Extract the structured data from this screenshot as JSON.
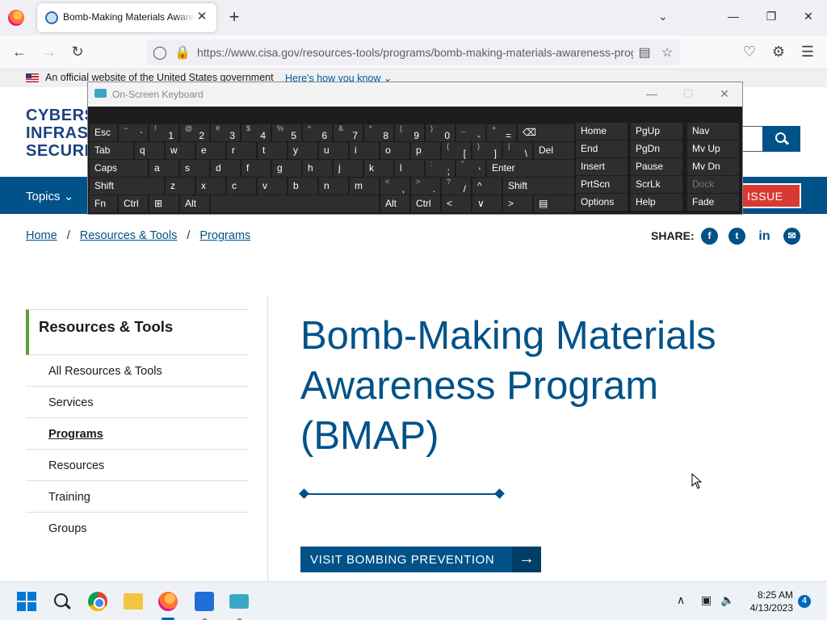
{
  "browser": {
    "tab_title": "Bomb-Making Materials Awareness Program (BMAP) | CISA",
    "tab_close": "✕",
    "new_tab": "+",
    "url": "https://www.cisa.gov/resources-tools/programs/bomb-making-materials-awareness-program-bmap"
  },
  "gov_banner": {
    "text": "An official website of the United States government",
    "link": "Here's how you know"
  },
  "site": {
    "logo_lines": [
      "CYBERSE",
      "INFRAST",
      "SECURIT"
    ],
    "topics_label": "Topics",
    "report_label": "R ISSUE"
  },
  "breadcrumb": [
    "Home",
    "Resources & Tools",
    "Programs"
  ],
  "breadcrumb_sep": "/",
  "share_label": "SHARE:",
  "social": [
    "f",
    "t",
    "in",
    "✉"
  ],
  "sidebar": {
    "heading": "Resources & Tools",
    "items": [
      {
        "label": "All Resources & Tools",
        "active": false
      },
      {
        "label": "Services",
        "active": false
      },
      {
        "label": "Programs",
        "active": true
      },
      {
        "label": "Resources",
        "active": false
      },
      {
        "label": "Training",
        "active": false
      },
      {
        "label": "Groups",
        "active": false
      }
    ]
  },
  "main": {
    "title": "Bomb-Making Materials Awareness Program (BMAP)",
    "cta_label": "VISIT BOMBING PREVENTION",
    "cta_arrow": "→"
  },
  "osk": {
    "title": "On-Screen Keyboard",
    "rows": [
      [
        {
          "l": "Esc"
        },
        {
          "s": "~",
          "m": "`"
        },
        {
          "s": "!",
          "m": "1"
        },
        {
          "s": "@",
          "m": "2"
        },
        {
          "s": "#",
          "m": "3"
        },
        {
          "s": "$",
          "m": "4"
        },
        {
          "s": "%",
          "m": "5"
        },
        {
          "s": "^",
          "m": "6"
        },
        {
          "s": "&",
          "m": "7"
        },
        {
          "s": "*",
          "m": "8"
        },
        {
          "s": "(",
          "m": "9"
        },
        {
          "s": ")",
          "m": "0"
        },
        {
          "s": "_",
          "m": "-"
        },
        {
          "s": "+",
          "m": "="
        },
        {
          "l": "⌫"
        }
      ],
      [
        {
          "l": "Tab"
        },
        {
          "l": "q"
        },
        {
          "l": "w"
        },
        {
          "l": "e"
        },
        {
          "l": "r"
        },
        {
          "l": "t"
        },
        {
          "l": "y"
        },
        {
          "l": "u"
        },
        {
          "l": "i"
        },
        {
          "l": "o"
        },
        {
          "l": "p"
        },
        {
          "s": "{",
          "m": "["
        },
        {
          "s": "}",
          "m": "]"
        },
        {
          "s": "|",
          "m": "\\"
        },
        {
          "l": "Del"
        }
      ],
      [
        {
          "l": "Caps"
        },
        {
          "l": "a"
        },
        {
          "l": "s"
        },
        {
          "l": "d"
        },
        {
          "l": "f"
        },
        {
          "l": "g"
        },
        {
          "l": "h"
        },
        {
          "l": "j"
        },
        {
          "l": "k"
        },
        {
          "l": "l"
        },
        {
          "s": ":",
          "m": ";"
        },
        {
          "s": "\"",
          "m": "'"
        },
        {
          "l": "Enter"
        }
      ],
      [
        {
          "l": "Shift"
        },
        {
          "l": "z"
        },
        {
          "l": "x"
        },
        {
          "l": "c"
        },
        {
          "l": "v"
        },
        {
          "l": "b"
        },
        {
          "l": "n"
        },
        {
          "l": "m"
        },
        {
          "s": "<",
          "m": ","
        },
        {
          "s": ">",
          "m": "."
        },
        {
          "s": "?",
          "m": "/"
        },
        {
          "l": "^"
        },
        {
          "l": "Shift"
        }
      ],
      [
        {
          "l": "Fn"
        },
        {
          "l": "Ctrl"
        },
        {
          "l": "⊞"
        },
        {
          "l": "Alt"
        },
        {
          "l": ""
        },
        {
          "l": "Alt"
        },
        {
          "l": "Ctrl"
        },
        {
          "l": "<"
        },
        {
          "l": "∨"
        },
        {
          "l": ">"
        },
        {
          "l": "▤"
        }
      ]
    ],
    "side": [
      [
        "Home",
        "PgUp",
        "Nav"
      ],
      [
        "End",
        "PgDn",
        "Mv Up"
      ],
      [
        "Insert",
        "Pause",
        "Mv Dn"
      ],
      [
        "PrtScn",
        "ScrLk",
        "Dock"
      ],
      [
        "Options",
        "Help",
        "Fade"
      ]
    ]
  },
  "taskbar": {
    "time": "8:25 AM",
    "date": "4/13/2023",
    "notifications": "4"
  }
}
